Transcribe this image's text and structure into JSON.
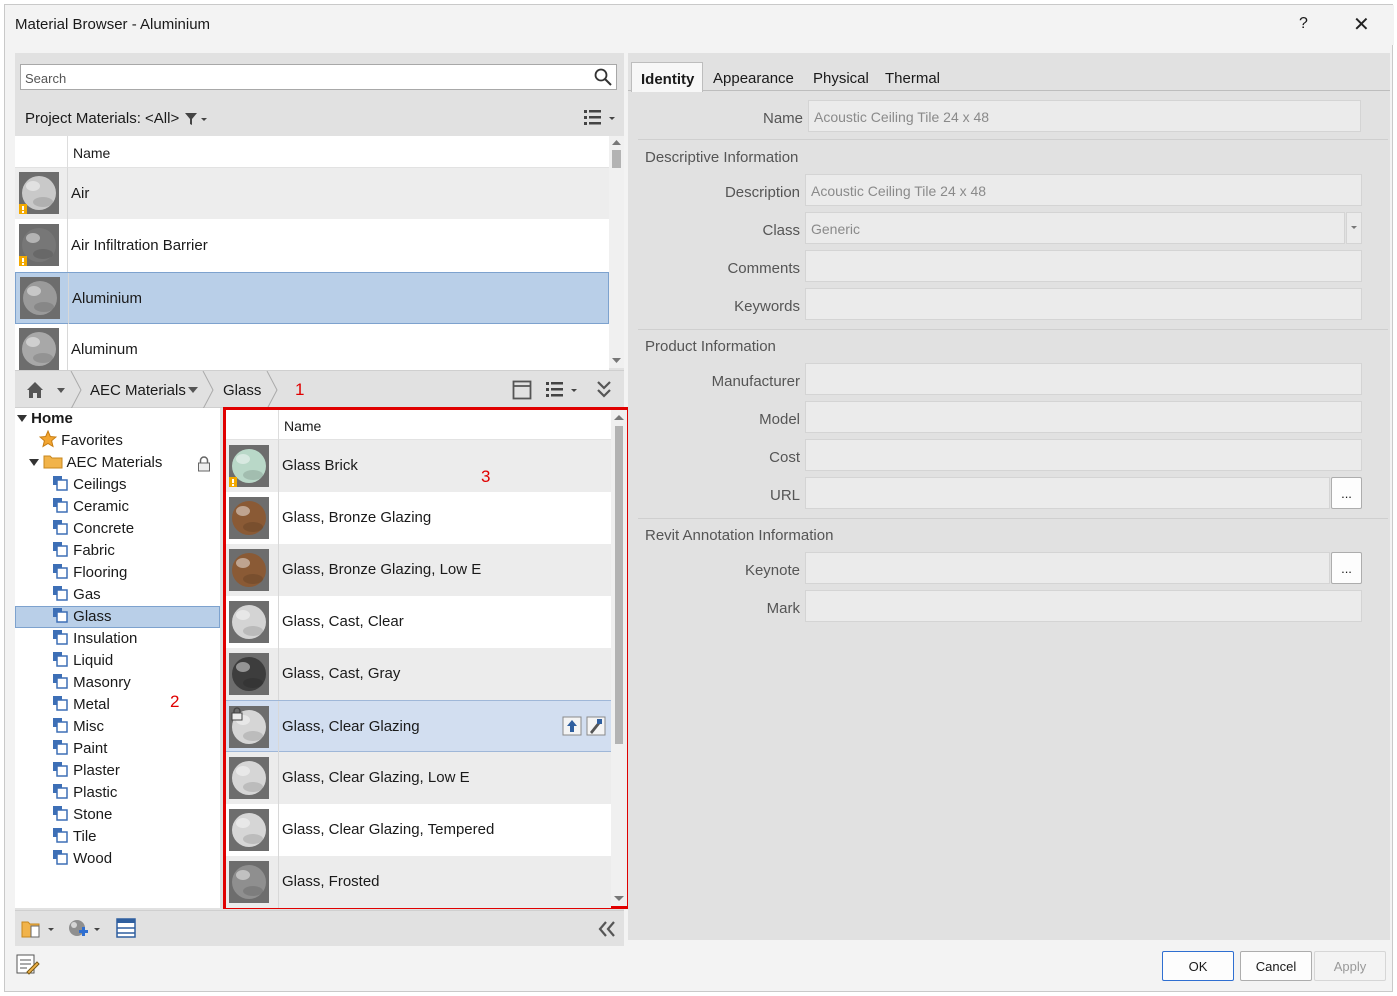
{
  "window": {
    "title": "Material Browser - Aluminium",
    "help": "?",
    "close": "✕"
  },
  "search": {
    "placeholder": "Search"
  },
  "project": {
    "label": "Project Materials: <All>",
    "column_name": "Name",
    "items": [
      {
        "label": "Air",
        "swatch": "#c9c9c9",
        "warn": true
      },
      {
        "label": "Air Infiltration Barrier",
        "swatch": "#777777",
        "warn": true
      },
      {
        "label": "Aluminium",
        "swatch": "#9a9a9a",
        "warn": false,
        "selected": true
      },
      {
        "label": "Aluminum",
        "swatch": "#a8a8a8",
        "warn": false
      }
    ]
  },
  "breadcrumb": {
    "home_icon": "home-icon",
    "library": "AEC Materials",
    "category": "Glass"
  },
  "annotations": {
    "a1": "1",
    "a2": "2",
    "a3": "3"
  },
  "tree": {
    "root": "Home",
    "favorites": "Favorites",
    "library": "AEC Materials",
    "categories": [
      "Ceilings",
      "Ceramic",
      "Concrete",
      "Fabric",
      "Flooring",
      "Gas",
      "Glass",
      "Insulation",
      "Liquid",
      "Masonry",
      "Metal",
      "Misc",
      "Paint",
      "Plaster",
      "Plastic",
      "Stone",
      "Tile",
      "Wood"
    ],
    "selected": "Glass"
  },
  "library_list": {
    "column_name": "Name",
    "items": [
      {
        "label": "Glass Brick",
        "swatch": "#b9d8c8",
        "warn": true
      },
      {
        "label": "Glass, Bronze Glazing",
        "swatch": "#8a5a35"
      },
      {
        "label": "Glass, Bronze Glazing, Low E",
        "swatch": "#8a5a35"
      },
      {
        "label": "Glass, Cast, Clear",
        "swatch": "#d4d4d4"
      },
      {
        "label": "Glass, Cast, Gray",
        "swatch": "#3d3d3d"
      },
      {
        "label": "Glass, Clear Glazing",
        "swatch": "#d6d6d6",
        "lock": true,
        "selected": true
      },
      {
        "label": "Glass, Clear Glazing, Low E",
        "swatch": "#d6d6d6"
      },
      {
        "label": "Glass, Clear Glazing, Tempered",
        "swatch": "#d6d6d6"
      },
      {
        "label": "Glass, Frosted",
        "swatch": "#8f8f8f"
      }
    ]
  },
  "tabs": [
    "Identity",
    "Appearance",
    "Physical",
    "Thermal"
  ],
  "identity": {
    "name_label": "Name",
    "name_value": "Acoustic Ceiling Tile 24 x 48",
    "descriptive_title": "Descriptive Information",
    "description_label": "Description",
    "description_value": "Acoustic Ceiling Tile 24 x 48",
    "class_label": "Class",
    "class_value": "Generic",
    "comments_label": "Comments",
    "keywords_label": "Keywords",
    "product_title": "Product Information",
    "manufacturer_label": "Manufacturer",
    "model_label": "Model",
    "cost_label": "Cost",
    "url_label": "URL",
    "revit_title": "Revit Annotation Information",
    "keynote_label": "Keynote",
    "mark_label": "Mark",
    "ellipsis": "..."
  },
  "footer": {
    "ok": "OK",
    "cancel": "Cancel",
    "apply": "Apply"
  },
  "colors": {
    "selection": "#b9cfe8",
    "highlight_border": "#e00000",
    "folder": "#f1b34a",
    "category_icon": "#3d6fb6"
  }
}
